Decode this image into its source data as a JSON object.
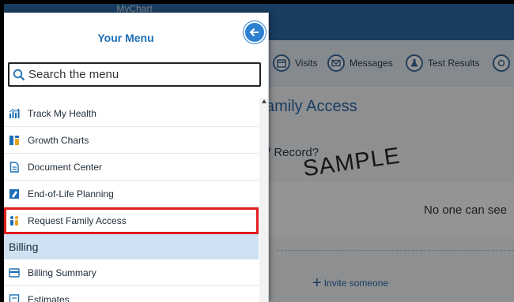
{
  "app": {
    "brand": "MyChart",
    "nav": [
      {
        "label": "Visits",
        "icon": "calendar-icon"
      },
      {
        "label": "Messages",
        "icon": "envelope-icon"
      },
      {
        "label": "Test Results",
        "icon": "flask-icon"
      }
    ],
    "page_heading": "amily Access",
    "sub_heading": "/ Record?",
    "card_text": "No one can see",
    "invite_label": "Invite someone",
    "watermark": "SAMPLE"
  },
  "menu": {
    "title": "Your Menu",
    "search_placeholder": "Search the menu",
    "items": [
      {
        "label": "Track My Health",
        "icon": "chart-icon"
      },
      {
        "label": "Growth Charts",
        "icon": "growth-chart-icon"
      },
      {
        "label": "Document Center",
        "icon": "document-icon"
      },
      {
        "label": "End-of-Life Planning",
        "icon": "planning-icon"
      },
      {
        "label": "Request Family Access",
        "icon": "family-icon",
        "highlighted": true
      }
    ],
    "section": "Billing",
    "billing_items": [
      {
        "label": "Billing Summary",
        "icon": "billing-icon"
      },
      {
        "label": "Estimates",
        "icon": "estimates-icon"
      }
    ]
  },
  "colors": {
    "accent": "#1f6fb6",
    "header_blue": "#2a6aa8",
    "highlight_red": "#e01e1e",
    "section_bg": "#cfe1f3"
  }
}
